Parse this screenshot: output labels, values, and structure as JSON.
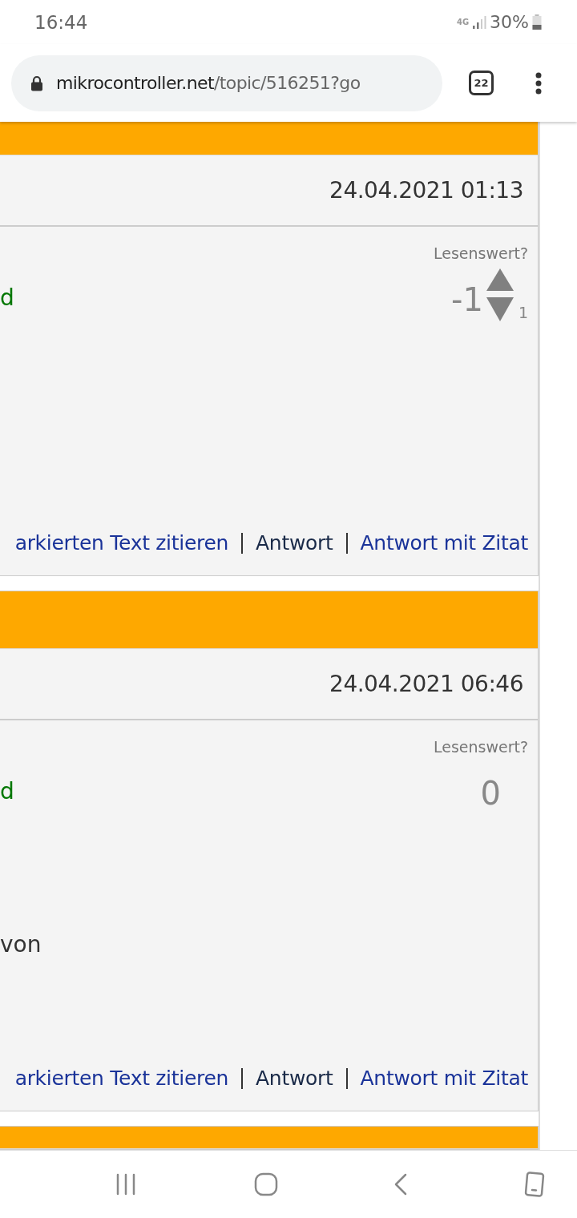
{
  "status_bar": {
    "time": "16:44",
    "network": "4G",
    "battery": "30%"
  },
  "browser": {
    "url_host": "mikrocontroller.net",
    "url_path": "/topic/516251?go",
    "tab_count": "22"
  },
  "posts": [
    {
      "date": "24.04.2021 01:13",
      "author": "d",
      "rating_label": "Lesenswert?",
      "score": "-1",
      "vote_arrows": true,
      "down_count": "1",
      "actions": [
        {
          "label": "arkierten Text zitieren",
          "visited": false
        },
        {
          "label": "Antwort",
          "visited": true
        },
        {
          "label": "Antwort mit Zitat",
          "visited": false
        }
      ]
    },
    {
      "date": "24.04.2021 06:46",
      "author": "d",
      "rating_label": "Lesenswert?",
      "score": "0",
      "vote_arrows": false,
      "text": "von",
      "actions": [
        {
          "label": "arkierten Text zitieren",
          "visited": false
        },
        {
          "label": "Antwort",
          "visited": true
        },
        {
          "label": "Antwort mit Zitat",
          "visited": false
        }
      ]
    }
  ]
}
